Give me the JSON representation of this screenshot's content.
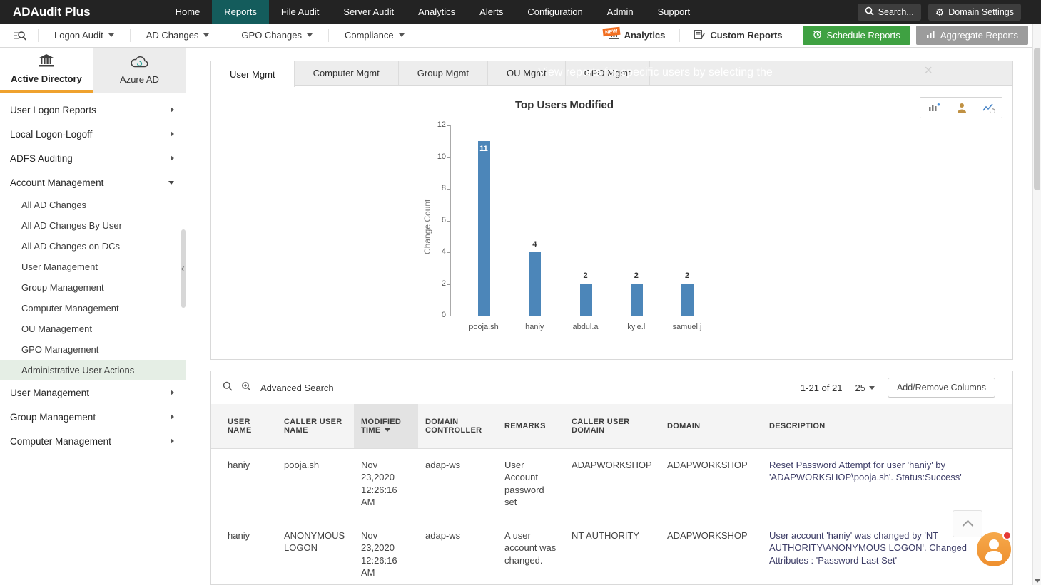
{
  "topnav": {
    "brand": "ADAudit Plus",
    "items": [
      {
        "label": "Home"
      },
      {
        "label": "Reports",
        "active": true
      },
      {
        "label": "File Audit"
      },
      {
        "label": "Server Audit"
      },
      {
        "label": "Analytics"
      },
      {
        "label": "Alerts"
      },
      {
        "label": "Configuration"
      },
      {
        "label": "Admin"
      },
      {
        "label": "Support"
      }
    ],
    "search_label": "Search...",
    "domain_settings_label": "Domain Settings"
  },
  "toolbar": {
    "dropdowns": [
      "Logon Audit",
      "AD Changes",
      "GPO Changes",
      "Compliance"
    ],
    "analytics_label": "Analytics",
    "analytics_badge": "NEW",
    "custom_reports_label": "Custom Reports",
    "schedule_reports_label": "Schedule Reports",
    "aggregate_reports_label": "Aggregate Reports"
  },
  "sidebar": {
    "tabs": [
      {
        "label": "Active Directory",
        "active": true
      },
      {
        "label": "Azure AD"
      }
    ],
    "menu": [
      {
        "label": "User Logon Reports",
        "arrow": "right"
      },
      {
        "label": "Local Logon-Logoff",
        "arrow": "right"
      },
      {
        "label": "ADFS Auditing",
        "arrow": "right"
      },
      {
        "label": "Account Management",
        "arrow": "down",
        "children": [
          "All AD Changes",
          "All AD Changes By User",
          "All AD Changes on DCs",
          "User Management",
          "Group Management",
          "Computer Management",
          "OU Management",
          "GPO Management",
          "Administrative User Actions"
        ],
        "selected_child": "Administrative User Actions"
      },
      {
        "label": "User Management",
        "arrow": "right"
      },
      {
        "label": "Group Management",
        "arrow": "right"
      },
      {
        "label": "Computer Management",
        "arrow": "right"
      }
    ]
  },
  "content": {
    "tabs": [
      "User Mgmt",
      "Computer Mgmt",
      "Group Mgmt",
      "OU Mgmt",
      "GPO Mgmt"
    ],
    "active_tab": "User Mgmt",
    "overlay_hint": "View reports for specific users by selecting the"
  },
  "chart_data": {
    "type": "bar",
    "title": "Top Users Modified",
    "ylabel": "Change Count",
    "xlabel": "",
    "categories": [
      "pooja.sh",
      "haniy",
      "abdul.a",
      "kyle.l",
      "samuel.j"
    ],
    "values": [
      11,
      4,
      2,
      2,
      2
    ],
    "ylim": [
      0,
      12
    ],
    "yticks": [
      0,
      2,
      4,
      6,
      8,
      10,
      12
    ],
    "bar_color": "#4c86b9",
    "grid": false,
    "legend": "none"
  },
  "table": {
    "advanced_search_label": "Advanced Search",
    "pagination": "1-21 of 21",
    "page_size": "25",
    "add_remove_columns_label": "Add/Remove Columns",
    "columns": [
      "USER NAME",
      "CALLER USER NAME",
      "MODIFIED TIME",
      "DOMAIN CONTROLLER",
      "REMARKS",
      "CALLER USER DOMAIN",
      "DOMAIN",
      "DESCRIPTION"
    ],
    "sorted_column": "MODIFIED TIME",
    "sort_direction": "desc",
    "rows": [
      {
        "user_name": "haniy",
        "caller_user_name": "pooja.sh",
        "modified_time": "Nov 23,2020 12:26:16 AM",
        "domain_controller": "adap-ws",
        "remarks": "User Account password set",
        "caller_user_domain": "ADAPWORKSHOP",
        "domain": "ADAPWORKSHOP",
        "description": "Reset Password Attempt for user 'haniy' by 'ADAPWORKSHOP\\pooja.sh'. Status:Success'"
      },
      {
        "user_name": "haniy",
        "caller_user_name": "ANONYMOUS LOGON",
        "modified_time": "Nov 23,2020 12:26:16 AM",
        "domain_controller": "adap-ws",
        "remarks": "A user account was changed.",
        "caller_user_domain": "NT AUTHORITY",
        "domain": "ADAPWORKSHOP",
        "description": "User account 'haniy' was changed by 'NT AUTHORITY\\ANONYMOUS LOGON'. Changed Attributes : 'Password Last Set'"
      }
    ]
  },
  "icons": [
    "search-icon",
    "gear-icon",
    "analytics-icon",
    "custom-reports-icon",
    "clock-icon",
    "aggregate-bars-icon",
    "building-icon",
    "cloud-icon",
    "chart-add-icon",
    "user-icon",
    "trend-refresh-icon",
    "advanced-search-icon",
    "close-icon",
    "chevron-up-icon",
    "chat-person-icon"
  ]
}
